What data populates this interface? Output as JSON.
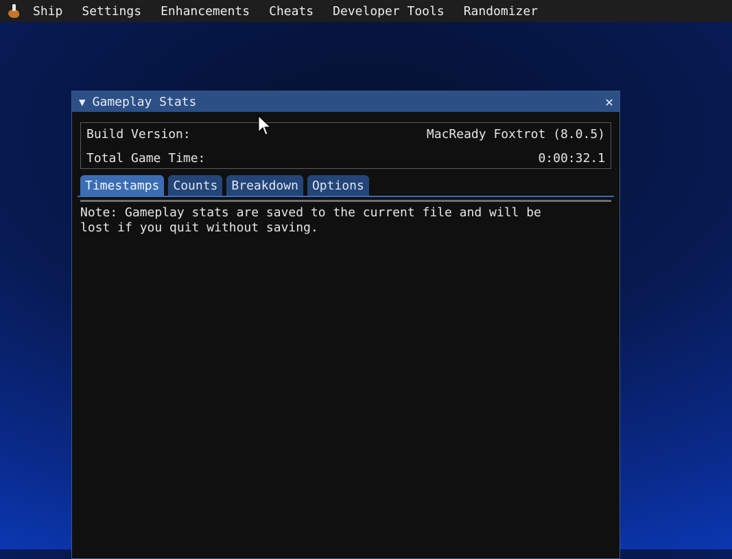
{
  "menubar": {
    "logo_icon": "ship-of-harkinian-logo",
    "items": [
      "Ship",
      "Settings",
      "Enhancements",
      "Cheats",
      "Developer Tools",
      "Randomizer"
    ]
  },
  "window": {
    "title": "Gameplay Stats",
    "collapse_icon": "triangle-down",
    "close_icon": "close-x",
    "info": {
      "build_version_label": "Build Version:",
      "build_version_value": "MacReady Foxtrot (8.0.5)",
      "total_game_time_label": "Total Game Time:",
      "total_game_time_value": "0:00:32.1"
    },
    "tabs": [
      {
        "label": "Timestamps",
        "active": true
      },
      {
        "label": "Counts",
        "active": false
      },
      {
        "label": "Breakdown",
        "active": false
      },
      {
        "label": "Options",
        "active": false
      }
    ],
    "note": "Note: Gameplay stats are saved to the current file and will be\nlost if you quit without saving."
  },
  "colors": {
    "titlebar": "#2c4f85",
    "tab_active": "#3b6db3",
    "tab_inactive": "#244578",
    "window_bg": "#101011",
    "menubar_bg": "#1e1e1f"
  }
}
